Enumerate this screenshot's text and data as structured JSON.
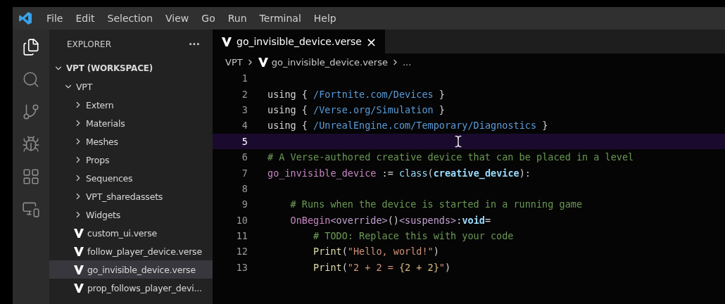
{
  "menu_bar": {
    "items": [
      "File",
      "Edit",
      "Selection",
      "View",
      "Go",
      "Run",
      "Terminal",
      "Help"
    ]
  },
  "activity_bar": {
    "items": [
      {
        "kind": "explorer",
        "selected": true
      },
      {
        "kind": "search",
        "selected": false
      },
      {
        "kind": "source-control",
        "selected": false
      },
      {
        "kind": "debug",
        "selected": false
      },
      {
        "kind": "extensions",
        "selected": false
      },
      {
        "kind": "remote",
        "selected": false
      }
    ]
  },
  "sidebar": {
    "title": "EXPLORER",
    "more": "···",
    "tree": [
      {
        "label": "VPT (WORKSPACE)",
        "kind": "root",
        "expanded": true,
        "selected": false,
        "children": [
          {
            "label": "VPT",
            "kind": "folder",
            "expanded": true,
            "selected": false,
            "children": [
              {
                "label": "Extern",
                "kind": "folder",
                "expanded": false,
                "selected": false
              },
              {
                "label": "Materials",
                "kind": "folder",
                "expanded": false,
                "selected": false
              },
              {
                "label": "Meshes",
                "kind": "folder",
                "expanded": false,
                "selected": false
              },
              {
                "label": "Props",
                "kind": "folder",
                "expanded": false,
                "selected": false
              },
              {
                "label": "Sequences",
                "kind": "folder",
                "expanded": false,
                "selected": false
              },
              {
                "label": "VPT_sharedassets",
                "kind": "folder",
                "expanded": false,
                "selected": false
              },
              {
                "label": "Widgets",
                "kind": "folder",
                "expanded": false,
                "selected": false
              },
              {
                "label": "custom_ui.verse",
                "kind": "file",
                "selected": false
              },
              {
                "label": "follow_player_device.verse",
                "kind": "file",
                "selected": false
              },
              {
                "label": "go_invisible_device.verse",
                "kind": "file",
                "selected": true
              },
              {
                "label": "prop_follows_player_devi...",
                "kind": "file",
                "selected": false
              }
            ]
          }
        ]
      }
    ]
  },
  "tabs": [
    {
      "label": "go_invisible_device.verse",
      "close": "×",
      "selected": true
    }
  ],
  "breadcrumb": [
    "VPT",
    "go_invisible_device.verse",
    "..."
  ],
  "editor": {
    "lines": [
      {
        "number": "1",
        "current": false
      },
      {
        "number": "2",
        "current": false,
        "tokens": [
          {
            "kind": "keyword",
            "text": "using "
          },
          {
            "kind": "punct",
            "text": "{ "
          },
          {
            "kind": "path",
            "text": "/Fortnite.com/Devices"
          },
          {
            "kind": "punct",
            "text": " }"
          }
        ]
      },
      {
        "number": "3",
        "current": false,
        "tokens": [
          {
            "kind": "keyword",
            "text": "using "
          },
          {
            "kind": "punct",
            "text": "{ "
          },
          {
            "kind": "path",
            "text": "/Verse.org/Simulation"
          },
          {
            "kind": "punct",
            "text": " }"
          }
        ]
      },
      {
        "number": "4",
        "current": false,
        "tokens": [
          {
            "kind": "keyword",
            "text": "using "
          },
          {
            "kind": "punct",
            "text": "{ "
          },
          {
            "kind": "path",
            "text": "/UnrealEngine.com/Temporary/Diagnostics"
          },
          {
            "kind": "punct",
            "text": " }"
          }
        ]
      },
      {
        "number": "5",
        "current": true
      },
      {
        "number": "6",
        "current": false,
        "tokens": [
          {
            "kind": "comment",
            "text": "# A Verse-authored creative device that can be placed in a level"
          }
        ]
      },
      {
        "number": "7",
        "current": false,
        "tokens": [
          {
            "kind": "ident",
            "text": "go_invisible_device"
          },
          {
            "kind": "punct",
            "text": " := "
          },
          {
            "kind": "type",
            "text": "class"
          },
          {
            "kind": "punct",
            "text": "("
          },
          {
            "kind": "type",
            "text": "creative_device"
          },
          {
            "kind": "punct",
            "text": "):"
          }
        ],
        "children": [
          {
            "number": "8",
            "current": false
          },
          {
            "number": "9",
            "current": false,
            "tokens": [
              {
                "kind": "comment",
                "text": "# Runs when the device is started in a running game"
              }
            ]
          },
          {
            "number": "10",
            "current": false,
            "tokens": [
              {
                "kind": "ident",
                "text": "OnBegin"
              },
              {
                "kind": "spec",
                "text": "<override>"
              },
              {
                "kind": "punct",
                "text": "()"
              },
              {
                "kind": "spec",
                "text": "<suspends>"
              },
              {
                "kind": "punct",
                "text": ":"
              },
              {
                "kind": "type",
                "text": "void"
              },
              {
                "kind": "punct",
                "text": "="
              }
            ],
            "children": [
              {
                "number": "11",
                "current": false,
                "tokens": [
                  {
                    "kind": "comment",
                    "text": "# TODO: Replace this with your code"
                  }
                ]
              },
              {
                "number": "12",
                "current": false,
                "tokens": [
                  {
                    "kind": "func",
                    "text": "Print"
                  },
                  {
                    "kind": "punct",
                    "text": "("
                  },
                  {
                    "kind": "string",
                    "text": "\"Hello, world!\""
                  },
                  {
                    "kind": "punct",
                    "text": ")"
                  }
                ]
              },
              {
                "number": "13",
                "current": false,
                "tokens": [
                  {
                    "kind": "func",
                    "text": "Print"
                  },
                  {
                    "kind": "punct",
                    "text": "("
                  },
                  {
                    "kind": "string",
                    "text": "\"2 + 2 = "
                  },
                  {
                    "kind": "interp",
                    "text": "{2 + 2}"
                  },
                  {
                    "kind": "string",
                    "text": "\""
                  },
                  {
                    "kind": "punct",
                    "text": ")"
                  }
                ]
              }
            ]
          }
        ]
      }
    ]
  }
}
